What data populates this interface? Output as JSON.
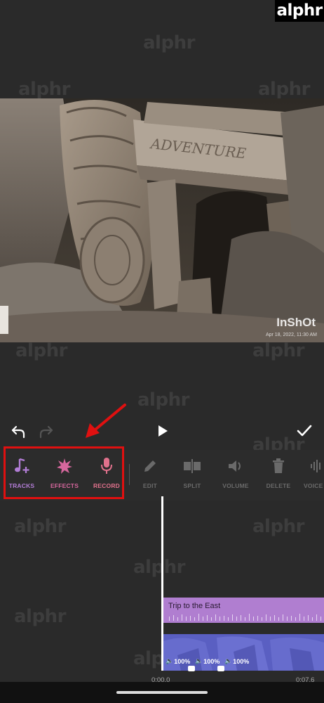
{
  "brand": {
    "badge": "alphr",
    "watermark": "alphr"
  },
  "preview": {
    "overlay_logo": "InShOt",
    "overlay_date": "Apr 18, 2022, 11:30 AM",
    "carved_sign_text": "ADVENTURE"
  },
  "controls": {
    "undo_icon": "undo-icon",
    "redo_icon": "redo-icon",
    "play_icon": "play-icon",
    "done_icon": "checkmark-icon"
  },
  "tools": [
    {
      "label": "TRACKS",
      "icon": "music-note-plus-icon",
      "color": "#b27dd6"
    },
    {
      "label": "EFFECTS",
      "icon": "burst-icon",
      "color": "#d6679d"
    },
    {
      "label": "RECORD",
      "icon": "microphone-icon",
      "color": "#e0718c"
    },
    {
      "label": "EDIT",
      "icon": "pencil-icon",
      "color": "#6a6a6a"
    },
    {
      "label": "SPLIT",
      "icon": "split-icon",
      "color": "#6a6a6a"
    },
    {
      "label": "VOLUME",
      "icon": "volume-icon",
      "color": "#6a6a6a"
    },
    {
      "label": "DELETE",
      "icon": "trash-icon",
      "color": "#6a6a6a"
    },
    {
      "label": "VOICE E",
      "icon": "voice-effect-icon",
      "color": "#6a6a6a"
    }
  ],
  "timeline": {
    "music_clip_title": "Trip to the East",
    "volumes": [
      "100%",
      "100%",
      "100%"
    ],
    "start_time": "0:00.0",
    "end_time": "0:07.6"
  },
  "colors": {
    "highlight": "#e01010",
    "music_clip": "#b07ed0",
    "video_clip": "#5a5fc2",
    "background": "#2a2a2a"
  }
}
